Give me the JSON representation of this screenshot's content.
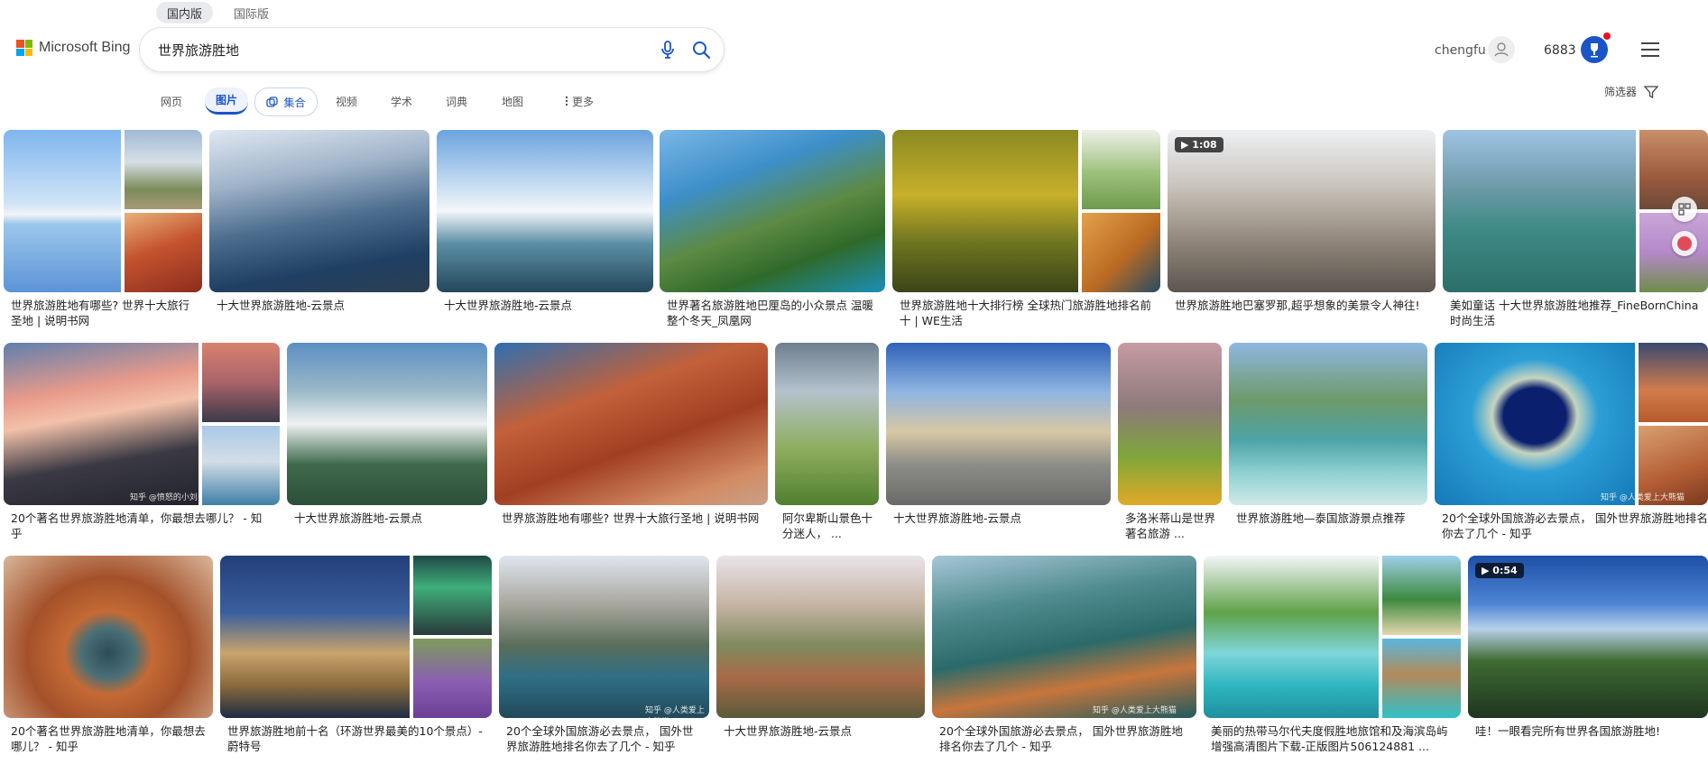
{
  "header": {
    "logo_text": "Microsoft Bing",
    "editions": [
      "国内版",
      "国际版"
    ],
    "search_query": "世界旅游胜地",
    "username": "chengfu",
    "points": "6883"
  },
  "tabs": [
    "网页",
    "图片",
    "集合",
    "视频",
    "学术",
    "词典",
    "地图",
    "更多"
  ],
  "filter_label": "筛选器",
  "colors": {
    "accent": "#1a54c7",
    "notification": "#e81123"
  },
  "results": [
    {
      "caption": "世界旅游胜地有哪些? 世界十大旅行圣地 | 说明书网"
    },
    {
      "caption": "十大世界旅游胜地-云景点"
    },
    {
      "caption": "十大世界旅游胜地-云景点"
    },
    {
      "caption": "世界著名旅游胜地巴厘岛的小众景点 温暖整个冬天_凤凰网"
    },
    {
      "caption": "世界旅游胜地十大排行榜 全球热门旅游胜地排名前十 | WE生活"
    },
    {
      "caption": "世界旅游胜地巴塞罗那,超乎想象的美景令人神往!",
      "duration": "1:08"
    },
    {
      "caption": "美如童话 十大世界旅游胜地推荐_FineBornChina时尚生活"
    },
    {
      "caption": "20个著名世界旅游胜地清单，你最想去哪儿？ - 知乎",
      "watermark": "知乎 @愤怒的小刘"
    },
    {
      "caption": "十大世界旅游胜地-云景点"
    },
    {
      "caption": "世界旅游胜地有哪些? 世界十大旅行圣地 | 说明书网"
    },
    {
      "caption": "阿尔卑斯山景色十分迷人， ..."
    },
    {
      "caption": "十大世界旅游胜地-云景点"
    },
    {
      "caption": "多洛米蒂山是世界著名旅游 ..."
    },
    {
      "caption": "世界旅游胜地—泰国旅游景点推荐"
    },
    {
      "caption": "20个全球外国旅游必去景点， 国外世界旅游胜地排名你去了几个 - 知乎",
      "watermark": "知乎 @人类爱上大熊猫"
    },
    {
      "caption": "20个著名世界旅游胜地清单，你最想去哪儿？ - 知乎"
    },
    {
      "caption": "世界旅游胜地前十名（环游世界最美的10个景点）-蔚特号"
    },
    {
      "caption": "20个全球外国旅游必去景点， 国外世界旅游胜地排名你去了几个 - 知乎",
      "watermark": "知乎 @人类爱上大熊猫"
    },
    {
      "caption": "十大世界旅游胜地-云景点"
    },
    {
      "caption": "20个全球外国旅游必去景点， 国外世界旅游胜地排名你去了几个 - 知乎",
      "watermark": "知乎 @人类爱上大熊猫"
    },
    {
      "caption": "美丽的热带马尔代夫度假胜地旅馆和及海滨岛屿增强高清图片下载-正版图片506124881 ..."
    },
    {
      "caption": "哇！一眼看完所有世界各国旅游胜地!",
      "duration": "0:54"
    }
  ]
}
